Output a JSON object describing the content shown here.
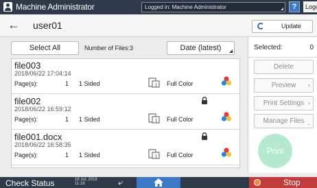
{
  "header": {
    "title": "Machine Administrator",
    "logged_in": "Logged in: Machine Administrator",
    "help": "?",
    "logout": "Logout"
  },
  "nav": {
    "folder": "user01",
    "update": "Update"
  },
  "list": {
    "select_all": "Select All",
    "num_files": "Number of Files:3",
    "sort": "Date (latest)",
    "files": [
      {
        "name": "file003",
        "date": "2018/06/22 17:04:14",
        "pages_label": "Page(s):",
        "pages": "1",
        "sided": "1 Sided",
        "color": "Full Color",
        "locked": false
      },
      {
        "name": "file002",
        "date": "2018/06/22 16:59:12",
        "pages_label": "Page(s):",
        "pages": "1",
        "sided": "1 Sided",
        "color": "Full Color",
        "locked": true
      },
      {
        "name": "file001.docx",
        "date": "2018/06/22 16:58:35",
        "pages_label": "Page(s):",
        "pages": "1",
        "sided": "1 Sided",
        "color": "Full Color",
        "locked": true
      }
    ]
  },
  "side": {
    "selected_label": "Selected:",
    "selected_count": "0",
    "delete": "Delete",
    "preview": "Preview",
    "print_settings": "Print Settings",
    "manage_files": "Manage Files",
    "print": "Print"
  },
  "footer": {
    "check_status": "Check Status",
    "date": "18 Jul. 2018",
    "time": "11:18",
    "stop": "Stop"
  },
  "colors": {
    "header_bg": "#2e3a4a",
    "accent_blue": "#3b78c6",
    "print_green": "#b6ead0",
    "stop_red": "#c23b3b"
  }
}
